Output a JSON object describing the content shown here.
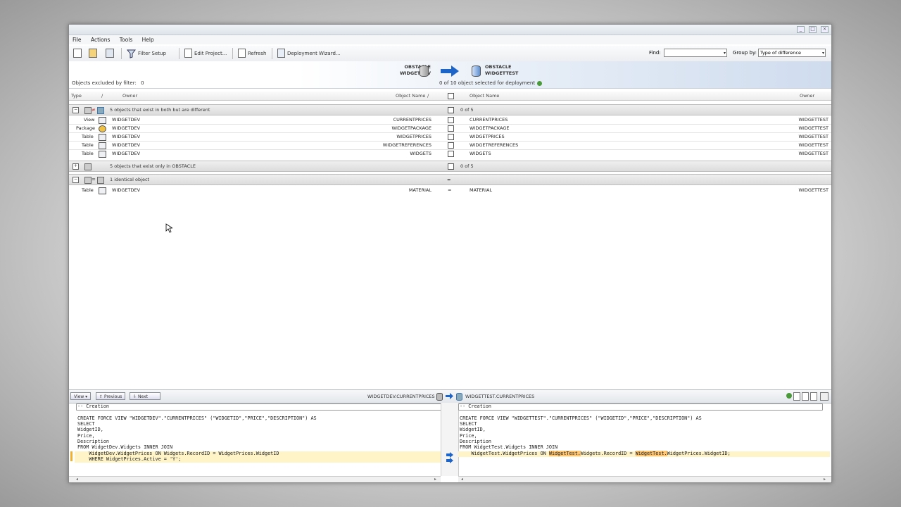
{
  "menu": [
    "File",
    "Actions",
    "Tools",
    "Help"
  ],
  "toolbar": {
    "filter_setup": "Filter Setup",
    "edit_project": "Edit Project...",
    "refresh": "Refresh",
    "deployment_wizard": "Deployment Wizard...",
    "find_label": "Find:",
    "find_value": "",
    "group_by_label": "Group by:",
    "group_by_value": "Type of difference"
  },
  "header": {
    "excluded_label": "Objects excluded by filter:",
    "excluded_count": "0",
    "source_server": "OBSTACLE",
    "source_schema": "WIDGETDEV",
    "target_server": "OBSTACLE",
    "target_schema": "WIDGETTEST",
    "selected_info": "0 of 10   object selected for deployment"
  },
  "columns": {
    "type": "Type",
    "sort": "/",
    "owner": "Owner",
    "object_name_left": "Object Name",
    "object_name_right": "Object Name",
    "owner_right": "Owner"
  },
  "groups": [
    {
      "label": "5 objects that exist in both but are different",
      "count": "0 of 5"
    },
    {
      "label": "5 objects that exist only in OBSTACLE",
      "count": "0 of 5"
    },
    {
      "label": "1 identical object",
      "count": "="
    }
  ],
  "rows_different": [
    {
      "type": "View",
      "owner": "WIDGETDEV",
      "name": "CURRENTPRICES",
      "tname": "CURRENTPRICES",
      "towner": "WIDGETTEST"
    },
    {
      "type": "Package",
      "owner": "WIDGETDEV",
      "name": "WIDGETPACKAGE",
      "tname": "WIDGETPACKAGE",
      "towner": "WIDGETTEST"
    },
    {
      "type": "Table",
      "owner": "WIDGETDEV",
      "name": "WIDGETPRICES",
      "tname": "WIDGETPRICES",
      "towner": "WIDGETTEST"
    },
    {
      "type": "Table",
      "owner": "WIDGETDEV",
      "name": "WIDGETREFERENCES",
      "tname": "WIDGETREFERENCES",
      "towner": "WIDGETTEST"
    },
    {
      "type": "Table",
      "owner": "WIDGETDEV",
      "name": "WIDGETS",
      "tname": "WIDGETS",
      "towner": "WIDGETTEST"
    }
  ],
  "rows_identical": [
    {
      "type": "Table",
      "owner": "WIDGETDEV",
      "name": "MATERIAL",
      "eq": "=",
      "tname": "MATERIAL",
      "towner": "WIDGETTEST"
    }
  ],
  "bottom": {
    "view_btn": "View",
    "previous_btn": "Previous",
    "next_btn": "Next",
    "left_object": "WIDGETDEV.CURRENTPRICES",
    "right_object": "WIDGETTEST.CURRENTPRICES"
  },
  "left_sql": [
    "-- Creation",
    "",
    "CREATE FORCE VIEW \"WIDGETDEV\".\"CURRENTPRICES\" (\"WIDGETID\",\"PRICE\",\"DESCRIPTION\") AS",
    "SELECT",
    "WidgetID,",
    "Price,",
    "Description",
    "FROM WidgetDev.Widgets INNER JOIN",
    "    WidgetDev.WidgetPrices ON Widgets.RecordID = WidgetPrices.WidgetID",
    "    WHERE WidgetPrices.Active = 'Y';"
  ],
  "right_sql": [
    "-- Creation",
    "",
    "CREATE FORCE VIEW \"WIDGETTEST\".\"CURRENTPRICES\" (\"WIDGETID\",\"PRICE\",\"DESCRIPTION\") AS",
    "SELECT",
    "WidgetID,",
    "Price,",
    "Description",
    "FROM WidgetTest.Widgets INNER JOIN",
    "    WidgetTest.WidgetPrices ON ",
    "WidgetTest.",
    "Widgets.RecordID = ",
    "WidgetTest.",
    "WidgetPrices.WidgetID;"
  ]
}
